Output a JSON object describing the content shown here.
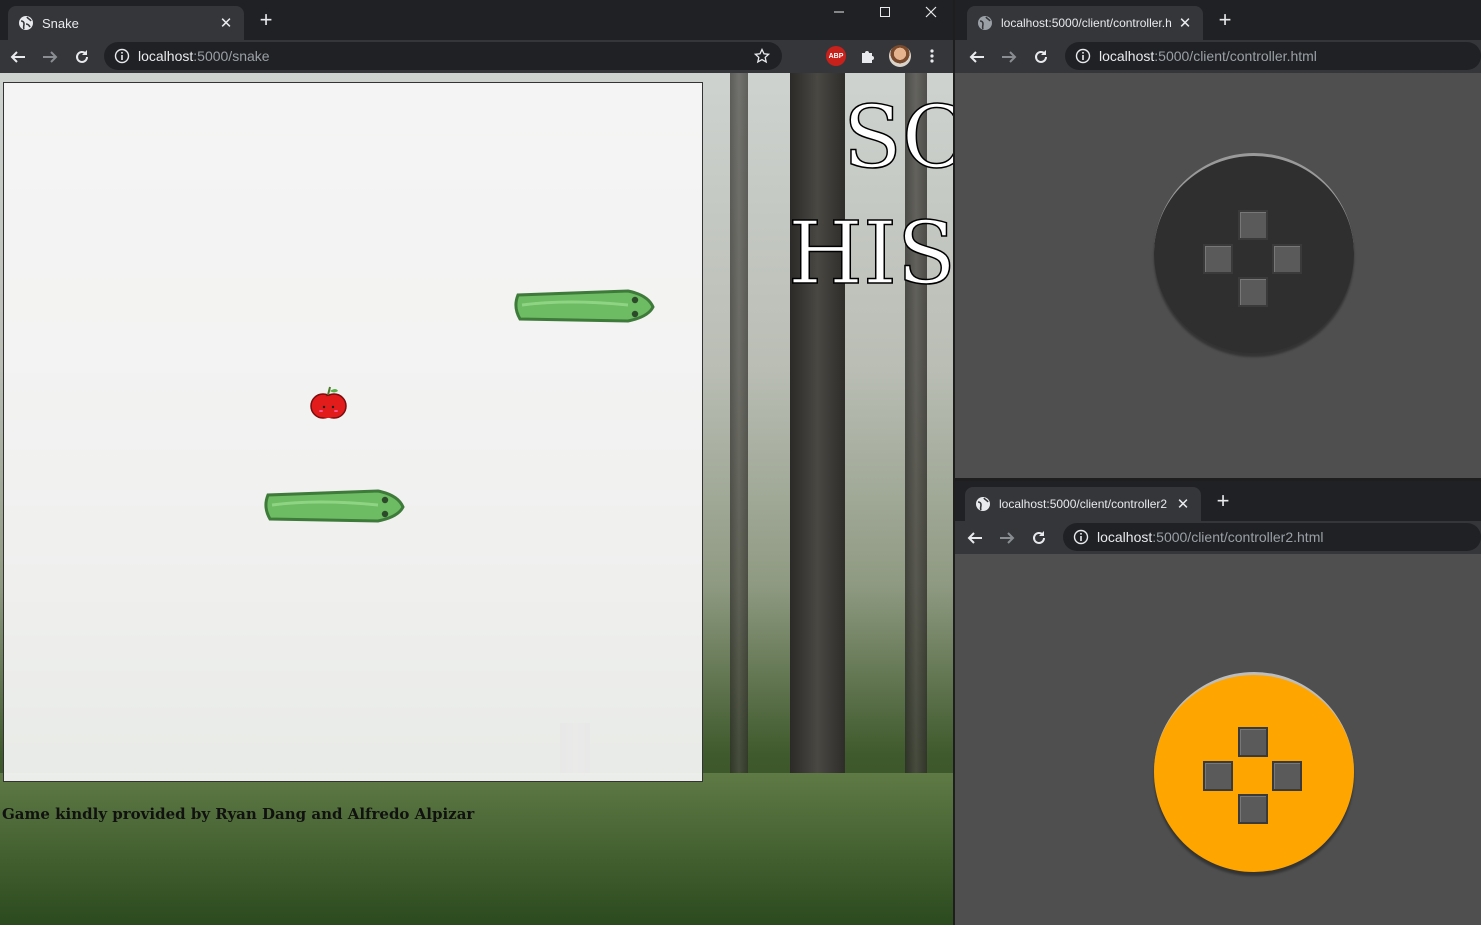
{
  "left_window": {
    "tab_title": "Snake",
    "url_host": "localhost",
    "url_rest": ":5000/snake",
    "extension_badge": "ABP"
  },
  "game": {
    "title_line1": "SC",
    "title_line2": "HIS",
    "credits": "Game kindly provided by Ryan Dang and Alfredo Alpizar",
    "snakes": [
      {
        "color": "#6dbb63",
        "direction": "right"
      },
      {
        "color": "#6dbb63",
        "direction": "right"
      }
    ],
    "apple_color": "#e21b1b"
  },
  "right_top_window": {
    "tab_title": "localhost:5000/client/controller.h",
    "url_host": "localhost",
    "url_rest": ":5000/client/controller.html",
    "pad_color": "#2f2f2f"
  },
  "right_bottom_window": {
    "tab_title": "localhost:5000/client/controller2",
    "url_host": "localhost",
    "url_rest": ":5000/client/controller2.html",
    "pad_color": "#ffa500"
  }
}
